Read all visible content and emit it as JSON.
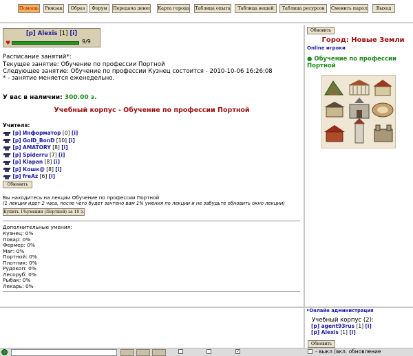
{
  "nav": {
    "items": [
      {
        "label": "Помощь",
        "active": true
      },
      {
        "label": "Рюкзак",
        "active": false
      },
      {
        "label": "Образ",
        "active": false
      },
      {
        "label": "Форум",
        "active": false
      },
      {
        "label": "Передача денег",
        "active": false
      },
      {
        "label": "Карта города",
        "active": false
      },
      {
        "label": "Таблица опыта",
        "active": false
      },
      {
        "label": "Таблица вещей",
        "active": false
      },
      {
        "label": "Таблица ресурсов",
        "active": false
      },
      {
        "label": "Сменить пароль",
        "active": false
      },
      {
        "label": "Выход",
        "active": false
      }
    ]
  },
  "character": {
    "tag": "[p]",
    "name": "Alexis",
    "level": "[1]",
    "info": "[i]",
    "hp_text": "9/9",
    "hp_fraction": 1.0
  },
  "schedule": {
    "title": "Расписание занятий*:",
    "current": "Текущее занятие: Обучение по профессии Портной",
    "next": "Следующее занятие: Обучение по профессии Кузнец состоится - 2010-10-06 16:26:08",
    "note": "* - занятие меняется еженедельно."
  },
  "balance": {
    "label": "У вас в наличии:",
    "value": "300.00 з."
  },
  "building_title": "Учебный корпус - Обучение по профессии Портной",
  "teachers": {
    "heading": "Учителя:",
    "list": [
      {
        "tag": "[p]",
        "name": "Информатор",
        "level": "[0]",
        "info": "[i]"
      },
      {
        "tag": "[p]",
        "name": "GolD_BonD",
        "level": "[10]",
        "info": "[i]"
      },
      {
        "tag": "[p]",
        "name": "AMATORY",
        "level": "[8]",
        "info": "[i]"
      },
      {
        "tag": "[p]",
        "name": "Spiderru",
        "level": "[7]",
        "info": "[i]"
      },
      {
        "tag": "[p]",
        "name": "Klapan",
        "level": "[8]",
        "info": "[i]"
      },
      {
        "tag": "[p]",
        "name": "Кошк@",
        "level": "[8]",
        "info": "[i]"
      },
      {
        "tag": "[p]",
        "name": "freAz",
        "level": "[6]",
        "info": "[i]"
      }
    ]
  },
  "refresh_label": "Обновить",
  "lecture": {
    "text": "Вы находитесь на лекции Обучение по профессии Портной",
    "note": "(1 лекция идет 2 часа, после чего будет зачтено вам 1% умения по лекции и не забудьте обновить окно лекции)",
    "buy_label": "Купить 1%умения (Портной) за 10 з."
  },
  "skills": {
    "heading": "Дополнительные умения:",
    "list": [
      "Кузнец: 0%",
      "Повар: 0%",
      "Фермер: 0%",
      "Маг: 0%",
      "Портной: 0%",
      "Плотник: 0%",
      "Рудокоп: 0%",
      "Лесоруб: 0%",
      "Рыбак: 0%",
      "Лекарь: 0%"
    ]
  },
  "right_panel": {
    "refresh_label": "Обновить",
    "city_title": "Город: Новые Земли",
    "online_link": "Online игроки",
    "location": "Обучение по профессии Портной"
  },
  "admin_panel": {
    "link": "Онлайн администрация",
    "building": "Учебный корпус (2):",
    "players": [
      {
        "tag": "[p]",
        "name": "agent93rus",
        "level": "[1]",
        "info": "[i]"
      },
      {
        "tag": "[p]",
        "name": "Alexis",
        "level": "[1]",
        "info": "[i]"
      }
    ],
    "refresh_label": "Обновить",
    "auto_refresh": "- выкл (вкл. обновление"
  },
  "colors": {
    "nav_bg": "#eae2cc",
    "nav_active_bg": "#f2b45a",
    "link_blue": "#1a1aa0",
    "title_maroon": "#9a1010",
    "money_green": "#1a8a1a"
  }
}
